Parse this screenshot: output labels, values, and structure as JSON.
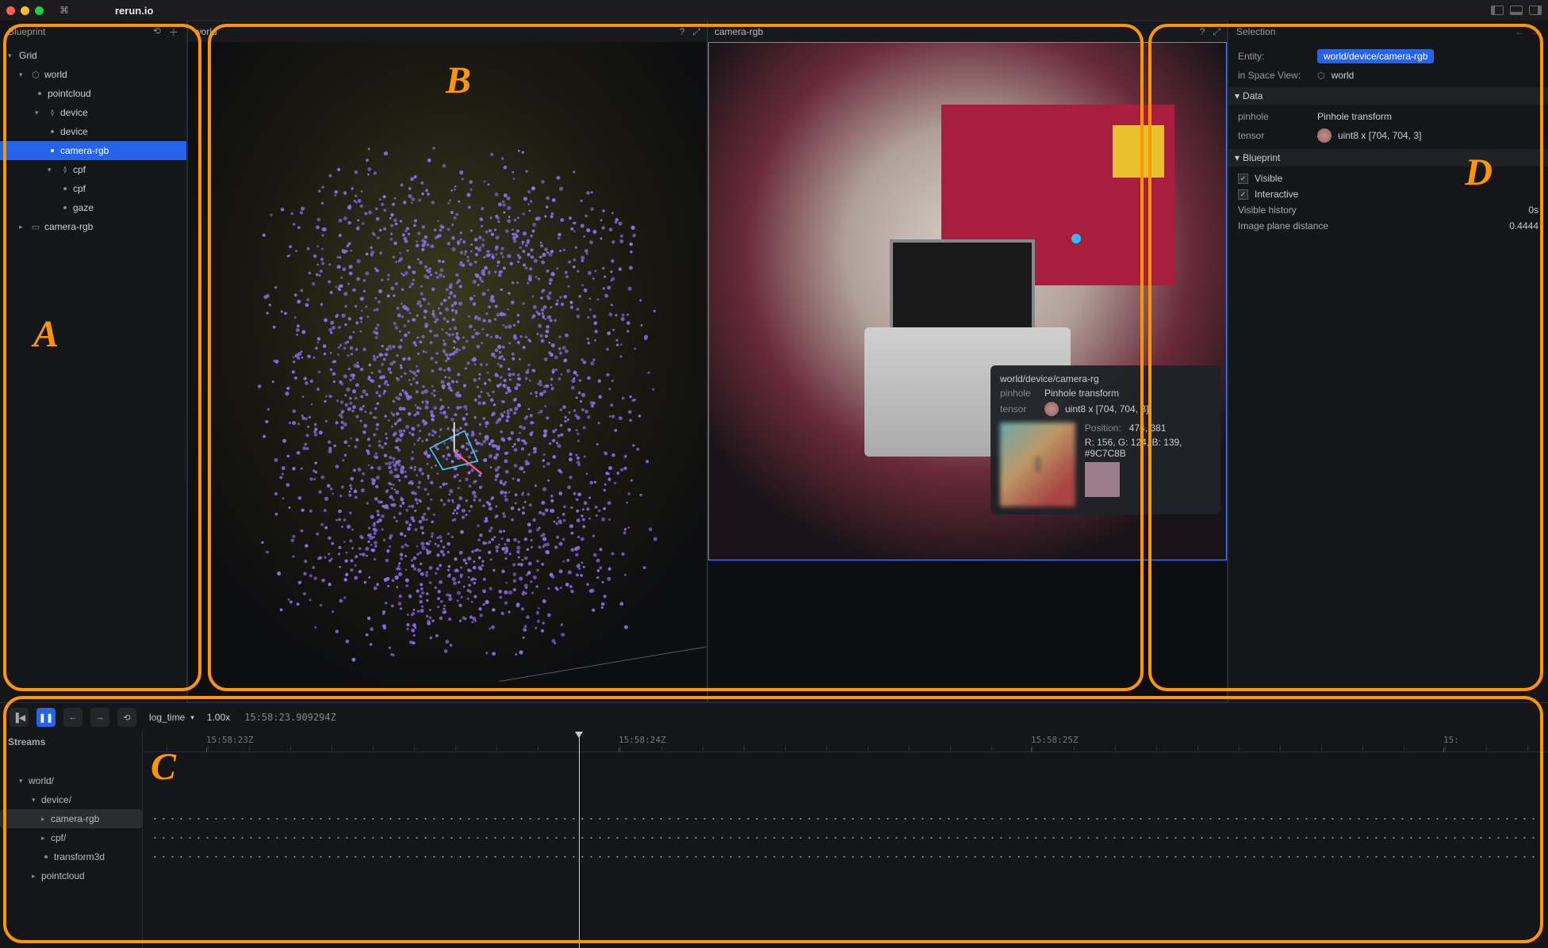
{
  "app": {
    "title": "rerun.io"
  },
  "annotations": {
    "a": "A",
    "b": "B",
    "c": "C",
    "d": "D"
  },
  "blueprint": {
    "title": "Blueprint",
    "root": "Grid",
    "items": [
      "world",
      "pointcloud",
      "device",
      "device",
      "camera-rgb",
      "cpf",
      "cpf",
      "gaze",
      "camera-rgb"
    ]
  },
  "viewports": {
    "world": {
      "title": "world"
    },
    "camera": {
      "title": "camera-rgb"
    }
  },
  "hover": {
    "path": "world/device/camera-rg",
    "pinhole_label": "pinhole",
    "pinhole_value": "Pinhole transform",
    "tensor_label": "tensor",
    "tensor_value": "uint8 x [704, 704, 3]",
    "pos_label": "Position:",
    "pos_value": "474, 381",
    "rgb_value": "R: 156, G: 124, B: 139, #9C7C8B"
  },
  "selection": {
    "title": "Selection",
    "entity_label": "Entity:",
    "entity_value": "world/device/camera-rgb",
    "space_view_label": "in Space View:",
    "space_view_value": "world",
    "data_header": "Data",
    "pinhole_label": "pinhole",
    "pinhole_value": "Pinhole transform",
    "tensor_label": "tensor",
    "tensor_value": "uint8 x [704, 704, 3]",
    "blueprint_header": "Blueprint",
    "visible": "Visible",
    "interactive": "Interactive",
    "visible_history_label": "Visible history",
    "visible_history_value": "0s",
    "image_plane_label": "Image plane distance",
    "image_plane_value": "0.4444"
  },
  "timeline": {
    "dropdown": "log_time",
    "speed": "1.00x",
    "timestamp": "15:58:23.909294Z",
    "streams_header": "Streams",
    "streams": [
      "world/",
      "device/",
      "camera-rgb",
      "cpf/",
      "transform3d",
      "pointcloud"
    ],
    "ticks": [
      "15:58:23Z",
      "15:58:24Z",
      "15:58:25Z",
      "15:"
    ]
  }
}
